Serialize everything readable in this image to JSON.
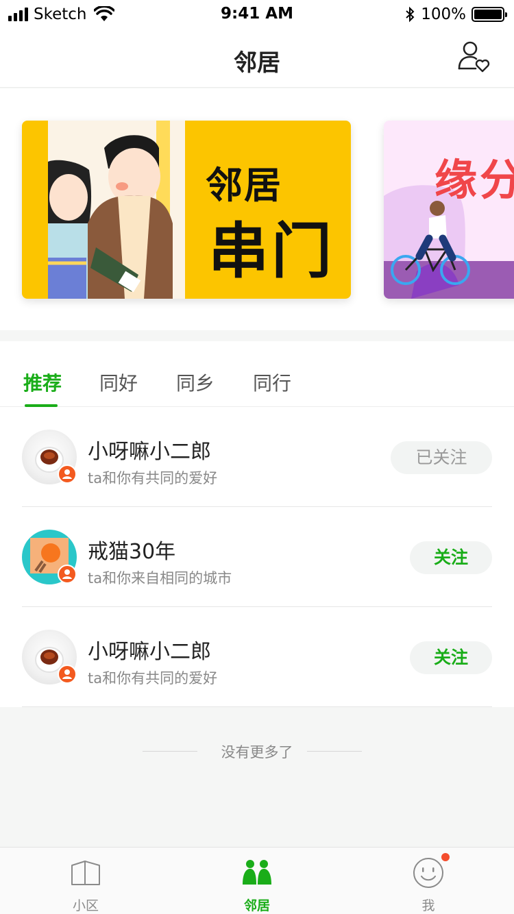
{
  "status_bar": {
    "carrier": "Sketch",
    "time": "9:41 AM",
    "battery": "100%"
  },
  "nav": {
    "title": "邻居",
    "action_icon": "user-heart-icon"
  },
  "banners": [
    {
      "line1": "邻居",
      "line2": "串门",
      "bg": "#fcc500"
    },
    {
      "line1": "缘分",
      "bg": "#fde8fb"
    }
  ],
  "tabs": [
    {
      "label": "推荐",
      "active": true
    },
    {
      "label": "同好"
    },
    {
      "label": "同乡"
    },
    {
      "label": "同行"
    }
  ],
  "users": [
    {
      "name": "小呀嘛小二郎",
      "desc": "ta和你有共同的爱好",
      "button": "已关注",
      "avatar": "coffee-cup"
    },
    {
      "name": "戒猫30年",
      "desc": "ta和你来自相同的城市",
      "button": "关注",
      "avatar": "light-bulb"
    },
    {
      "name": "小呀嘛小二郎",
      "desc": "ta和你有共同的爱好",
      "button": "关注",
      "avatar": "coffee-cup"
    }
  ],
  "footer_note": "没有更多了",
  "tab_bar": [
    {
      "label": "小区",
      "icon": "building-icon"
    },
    {
      "label": "邻居",
      "icon": "neighbors-icon",
      "active": true
    },
    {
      "label": "我",
      "icon": "smiley-icon",
      "badge": true
    }
  ],
  "colors": {
    "accent": "#1aad19",
    "badge": "#f35a1f",
    "notification_dot": "#f44d2e"
  }
}
